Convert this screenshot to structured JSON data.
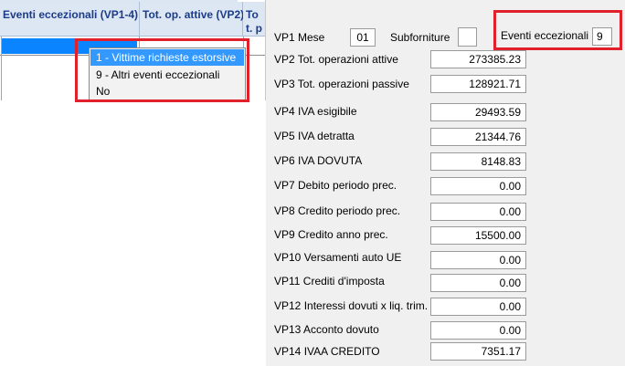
{
  "grid": {
    "columns": [
      "Eventi eccezionali (VP1-4)",
      "Tot. op. attive (VP2)",
      "Tot. pas"
    ]
  },
  "dropdown": {
    "options": [
      "1 - Vittime richieste estorsive",
      "9 - Altri eventi eccezionali",
      "No"
    ],
    "selected_index": 0
  },
  "form": {
    "vp1_label": "VP1 Mese",
    "vp1_value": "01",
    "subforniture_label": "Subforniture",
    "subforniture_value": "",
    "eventi_label": "Eventi eccezionali",
    "eventi_value": "9",
    "rows": [
      {
        "label": "VP2 Tot. operazioni attive",
        "value": "273385.23"
      },
      {
        "label": "VP3 Tot. operazioni passive",
        "value": "128921.71"
      },
      {
        "label": "VP4 IVA esigibile",
        "value": "29493.59"
      },
      {
        "label": "VP5 IVA detratta",
        "value": "21344.76"
      },
      {
        "label": "VP6 IVA DOVUTA",
        "value": "8148.83"
      },
      {
        "label": "VP7 Debito periodo prec.",
        "value": "0.00"
      },
      {
        "label": "VP8 Credito periodo prec.",
        "value": "0.00"
      },
      {
        "label": "VP9 Credito anno prec.",
        "value": "15500.00"
      },
      {
        "label": "VP10 Versamenti auto UE",
        "value": "0.00"
      },
      {
        "label": "VP11 Crediti d'imposta",
        "value": "0.00"
      },
      {
        "label": "VP12 Interessi dovuti x liq. trim.",
        "value": "0.00"
      },
      {
        "label": "VP13 Acconto dovuto",
        "value": "0.00"
      },
      {
        "label": "VP14 IVAA CREDITO",
        "value": "7351.17"
      }
    ]
  },
  "colors": {
    "highlight_border": "#e0202a",
    "selection": "#3399ff",
    "header_text": "#1b3b8a"
  }
}
